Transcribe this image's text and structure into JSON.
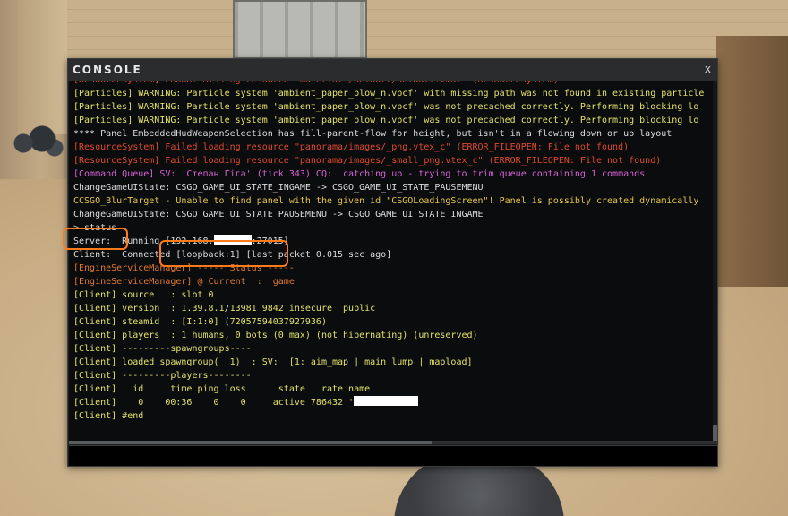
{
  "console": {
    "title": "CONSOLE",
    "close_label": "x",
    "input_placeholder": "",
    "lines": [
      {
        "text": "[ResourceSystem] ERROR: Missing resource \"materials/default/default.vmat\" (ResourceSystem)",
        "color": "red"
      },
      {
        "text": "[Particles] WARNING: Particle system 'ambient_paper_blow_n.vpcf' with missing path was not found in existing particle",
        "color": "yellow"
      },
      {
        "text": "[Particles] WARNING: Particle system 'ambient_paper_blow_n.vpcf' was not precached correctly. Performing blocking lo",
        "color": "yellow"
      },
      {
        "text": "[Particles] WARNING: Particle system 'ambient_paper_blow_n.vpcf' was not precached correctly. Performing blocking lo",
        "color": "yellow"
      },
      {
        "text": "**** Panel EmbeddedHudWeaponSelection has fill-parent-flow for height, but isn't in a flowing down or up layout",
        "color": "white"
      },
      {
        "text": "[ResourceSystem] Failed loading resource \"panorama/images/_png.vtex_c\" (ERROR_FILEOPEN: File not found)",
        "color": "red"
      },
      {
        "text": "[ResourceSystem] Failed loading resource \"panorama/images/_small_png.vtex_c\" (ERROR_FILEOPEN: File not found)",
        "color": "red"
      },
      {
        "text": "[Command Queue] SV: 'Степан Гіга' (tick 343) CQ:  catching up - trying to trim queue containing 1 commands",
        "color": "magenta"
      },
      {
        "text": "ChangeGameUIState: CSGO_GAME_UI_STATE_INGAME -> CSGO_GAME_UI_STATE_PAUSEMENU",
        "color": "white"
      },
      {
        "text": "CCSGO_BlurTarget - Unable to find panel with the given id \"CSGOLoadingScreen\"! Panel is possibly created dynamically",
        "color": "gold"
      },
      {
        "text": "ChangeGameUIState: CSGO_GAME_UI_STATE_PAUSEMENU -> CSGO_GAME_UI_STATE_INGAME",
        "color": "white"
      },
      {
        "text": "> status",
        "color": "white"
      },
      {
        "text": "Server:  Running [192.168.",
        "color": "white",
        "redact_after": true,
        "tail": ":27015]"
      },
      {
        "text": "Client:  Connected [loopback:1] [last packet 0.015 sec ago]",
        "color": "white"
      },
      {
        "text": "[EngineServiceManager] ----- Status -----",
        "color": "orange"
      },
      {
        "text": "[EngineServiceManager] @ Current  :  game",
        "color": "orange"
      },
      {
        "text": "[Client] source   : slot 0",
        "color": "yellow"
      },
      {
        "text": "[Client] version  : 1.39.8.1/13981 9842 insecure  public",
        "color": "yellow"
      },
      {
        "text": "[Client] steamid  : [I:1:0] (72057594037927936)",
        "color": "yellow"
      },
      {
        "text": "[Client] players  : 1 humans, 0 bots (0 max) (not hibernating) (unreserved)",
        "color": "yellow"
      },
      {
        "text": "[Client] ---------spawngroups----",
        "color": "yellow"
      },
      {
        "text": "[Client] loaded spawngroup(  1)  : SV:  [1: aim_map | main lump | mapload]",
        "color": "yellow"
      },
      {
        "text": "[Client] ---------players--------",
        "color": "yellow"
      },
      {
        "text": "[Client]   id     time ping loss      state   rate name",
        "color": "yellow"
      },
      {
        "text": "[Client]    0    00:36    0    0     active 786432 '",
        "color": "yellow",
        "redact_after": true,
        "tail": ""
      },
      {
        "text": "[Client] #end",
        "color": "yellow"
      }
    ]
  },
  "colors": {
    "white": "#dcdcdc",
    "yellow": "#e3e26a",
    "red": "#e0492e",
    "orange": "#e07a35",
    "magenta": "#d862d8",
    "gold": "#e6c84a",
    "highlight": "#ff7a1a"
  },
  "scrollbars": {
    "horizontal_position": 0.56,
    "vertical_position": 1.0
  }
}
